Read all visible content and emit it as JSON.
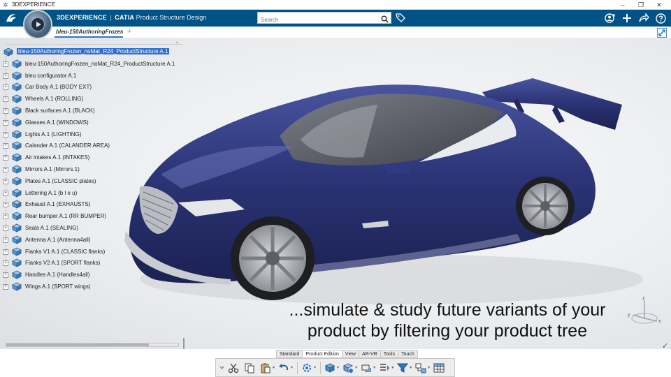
{
  "window": {
    "title": "3DEXPERIENCE",
    "controls": [
      "–",
      "❐",
      "✕"
    ]
  },
  "header": {
    "brand": "3DEXPERIENCE",
    "separator": "|",
    "product": "CATIA",
    "app": "Product Structure Design",
    "search_placeholder": "Search"
  },
  "tabs": {
    "active_tab": "bleu-150AuthoringFrozen",
    "add": "+"
  },
  "tree": {
    "collapse_glyph": "‹",
    "root": "bleu-150AuthoringFrozen_noMat_R24_ProductStructure A.1",
    "items": [
      "bleu-150AuthoringFrozen_noMat_R24_ProductStructure A.1",
      "bleu configurator A.1",
      "Car Body A.1 (BODY EXT)",
      "Wheels A.1 (ROLLING)",
      "Black surfaces A.1 (BLACK)",
      "Glasses A.1 (WINDOWS)",
      "Lights A.1 (LIGHTING)",
      "Calander A.1 (CALANDER AREA)",
      "Air intakes A.1 (INTAKES)",
      "Mirrors A.1 (Mirrors.1)",
      "Plates A.1 (CLASSIC plates)",
      "Lettering A.1 (b l e u)",
      "Exhaust A.1 (EXHAUSTS)",
      "Rear bumper A.1 (RR BUMPER)",
      "Seals A.1 (SEALING)",
      "Antenna A.1 (Antenna4all)",
      "Flanks V1 A.1 (CLASSIC flanks)",
      "Flanks V2 A.1 (SPORT flanks)",
      "Handles A.1 (Handles4all)",
      "Wings A.1 (SPORT wings)"
    ]
  },
  "caption": {
    "line1": "...simulate & study future variants of your",
    "line2": "product by filtering your product tree"
  },
  "compass_axis": {
    "z": "z",
    "x": "x",
    "y": "y"
  },
  "action_bar": {
    "tabs": [
      "Standard",
      "Product Edition",
      "View",
      "AR-VR",
      "Tools",
      "Touch"
    ],
    "active_tab": "Product Edition"
  },
  "colors": {
    "header_bg": "#005386",
    "selection": "#2f6fcf",
    "car_body": "#2c3577"
  }
}
